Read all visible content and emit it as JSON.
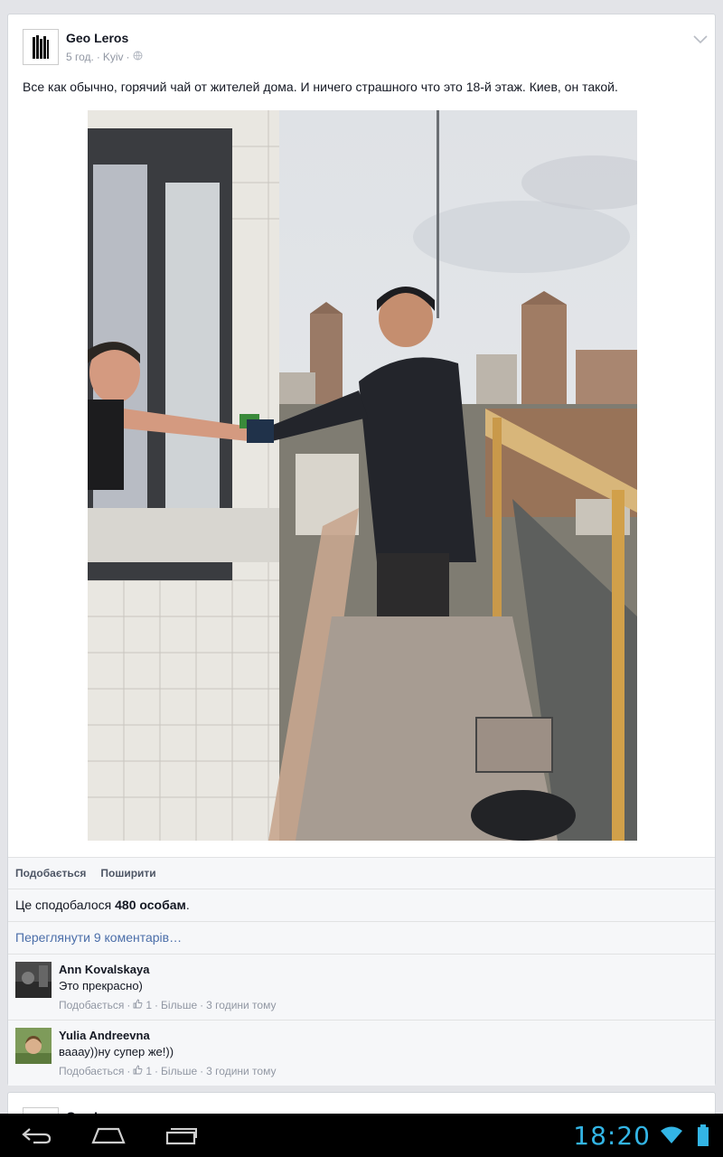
{
  "post": {
    "author": "Geo Leros",
    "time": "5 год.",
    "location": "Kyiv",
    "text": "Все как обычно, горячий чай от жителей дома. И ничего страшного что это 18-й этаж. Киев, он такой.",
    "actions": {
      "like": "Подобається",
      "share": "Поширити"
    },
    "likes_prefix": "Це сподобалося ",
    "likes_count": "480 особам",
    "likes_suffix": ".",
    "view_comments": "Переглянути 9 коментарів…",
    "comments": [
      {
        "name": "Ann Kovalskaya",
        "text": "Это прекрасно)",
        "like": "Подобається",
        "likes": "1",
        "more": "Більше",
        "time": "3 години тому"
      },
      {
        "name": "Yulia Andreevna",
        "text": "вааау))ну супер же!))",
        "like": "Подобається",
        "likes": "1",
        "more": "Більше",
        "time": "3 години тому"
      }
    ]
  },
  "post2": {
    "author": "Geo Leros"
  },
  "status_bar": {
    "time": "18:20"
  },
  "icons": [
    "chevron-down-icon",
    "globe-icon",
    "thumbs-up-icon",
    "back-icon",
    "home-icon",
    "recent-apps-icon",
    "wifi-icon",
    "battery-icon"
  ],
  "colors": {
    "link": "#4b6ea9",
    "meta": "#9197a3",
    "clock": "#33b5e5",
    "background": "#e3e4e8"
  }
}
